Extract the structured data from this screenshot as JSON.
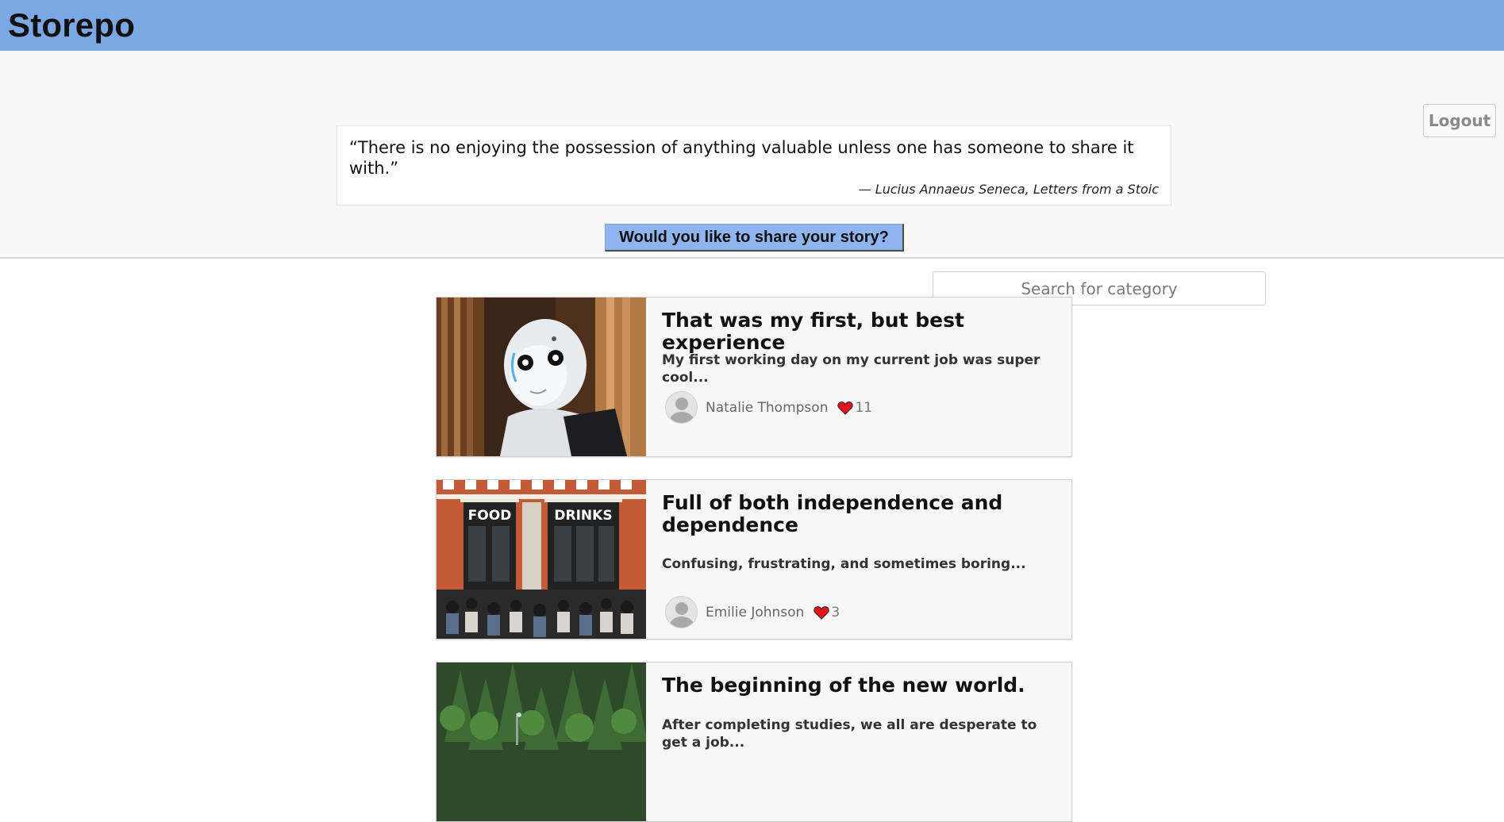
{
  "app": {
    "brand": "Storepo"
  },
  "header": {
    "logout_label": "Logout",
    "quote": {
      "text": "“There is no enjoying the possession of anything valuable unless one has someone to share it with.”",
      "attribution": "— Lucius Annaeus Seneca, Letters from a Stoic"
    },
    "share_label": "Would you like to share your story?",
    "search": {
      "placeholder": "Search for category",
      "value": ""
    }
  },
  "stories": [
    {
      "title": "That was my first, but best experience",
      "excerpt": "My first working day on my current job was super cool...",
      "author": "Natalie Thompson",
      "likes": "11",
      "image_icon": "robot-photo"
    },
    {
      "title": "Full of both independence and dependence",
      "excerpt": "Confusing, frustrating, and sometimes boring...",
      "author": "Emilie Johnson",
      "likes": "3",
      "image_icon": "cafe-street-photo",
      "image_signs": [
        "FOOD",
        "DRINKS"
      ]
    },
    {
      "title": "The beginning of the new world.",
      "excerpt": "After completing studies, we all are desperate to get a job...",
      "author": "",
      "likes": "",
      "image_icon": "forest-photo"
    }
  ],
  "colors": {
    "topbar": "#7ba7e3",
    "share_button": "#8fb4ee",
    "heart": "#e3141b"
  }
}
